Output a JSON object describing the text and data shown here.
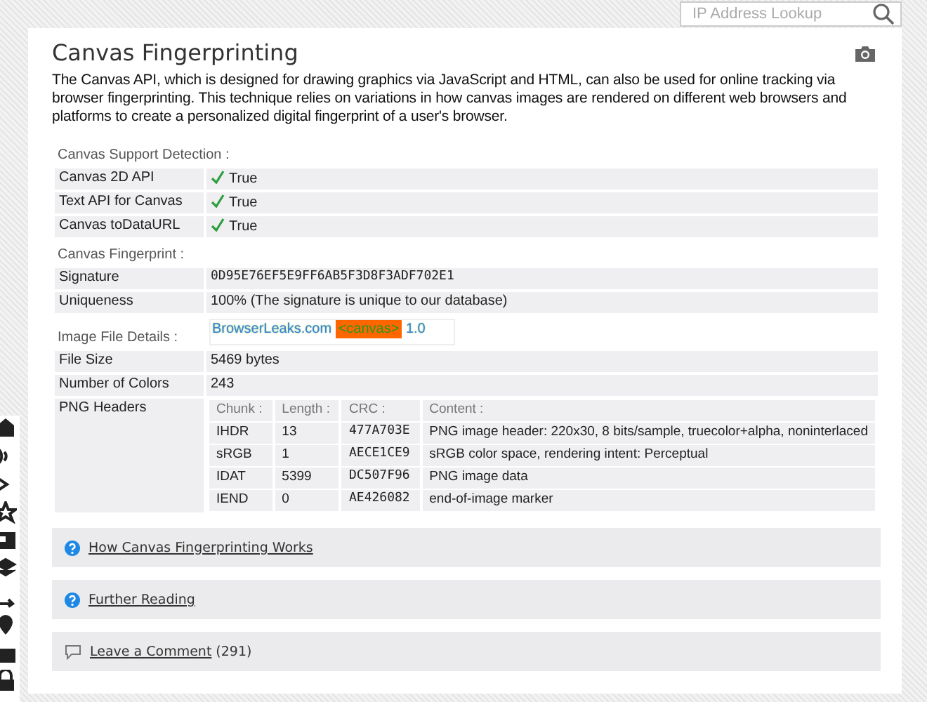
{
  "search": {
    "placeholder": "IP Address Lookup"
  },
  "title": "Canvas Fingerprinting",
  "description": "The Canvas API, which is designed for drawing graphics via JavaScript and HTML, can also be used for online tracking via browser fingerprinting. This technique relies on variations in how canvas images are rendered on different web browsers and platforms to create a personalized digital fingerprint of a user's browser.",
  "support": {
    "heading": "Canvas Support Detection :",
    "rows": [
      {
        "label": "Canvas 2D API",
        "value": "True",
        "supported": true
      },
      {
        "label": "Text API for Canvas",
        "value": "True",
        "supported": true
      },
      {
        "label": "Canvas toDataURL",
        "value": "True",
        "supported": true
      }
    ]
  },
  "fingerprint": {
    "heading": "Canvas Fingerprint :",
    "rows": [
      {
        "label": "Signature",
        "value": "0D95E76EF5E9FF6AB5F3D8F3ADF702E1",
        "kind": "mono"
      },
      {
        "label": "Uniqueness",
        "value": "100% (The signature is unique to our database)",
        "kind": "text"
      }
    ]
  },
  "image_details": {
    "heading": "Image File Details :",
    "canvas_image": {
      "site": "BrowserLeaks.com",
      "tag": "<canvas>",
      "version": "1.0"
    },
    "rows": [
      {
        "label": "File Size",
        "value": "5469 bytes"
      },
      {
        "label": "Number of Colors",
        "value": "243"
      }
    ],
    "png_headers": {
      "label": "PNG Headers",
      "columns": [
        "Chunk :",
        "Length :",
        "CRC :",
        "Content :"
      ],
      "rows": [
        [
          "IHDR",
          "13",
          "477A703E",
          "PNG image header: 220x30, 8 bits/sample, truecolor+alpha, noninterlaced"
        ],
        [
          "sRGB",
          "1",
          "AECE1CE9",
          "sRGB color space, rendering intent: Perceptual"
        ],
        [
          "IDAT",
          "5399",
          "DC507F96",
          "PNG image data"
        ],
        [
          "IEND",
          "0",
          "AE426082",
          "end-of-image marker"
        ]
      ]
    }
  },
  "panels": [
    {
      "kind": "help",
      "link": "How Canvas Fingerprinting Works"
    },
    {
      "kind": "help",
      "link": "Further Reading"
    },
    {
      "kind": "comment",
      "link": "Leave a Comment",
      "count": "(291)"
    }
  ]
}
